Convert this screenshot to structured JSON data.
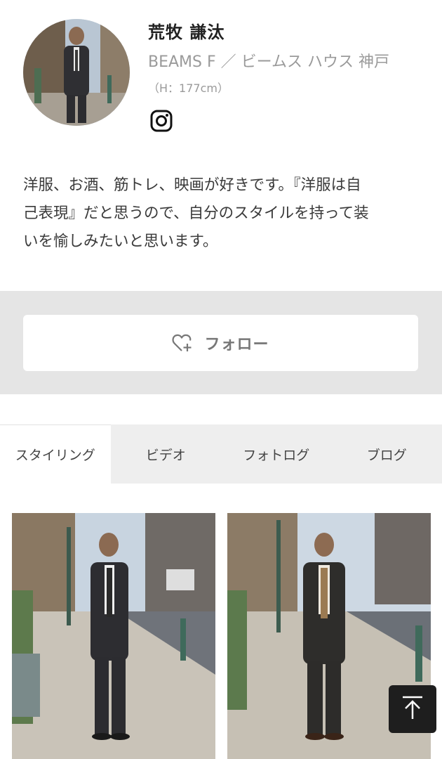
{
  "profile": {
    "name": "荒牧 謙汰",
    "shop": "BEAMS F ／ ビームス ハウス 神戸",
    "height": "（H：177cm）",
    "social_icon": "instagram-icon"
  },
  "bio": {
    "lines": [
      "洋服、お酒、筋トレ、映画が好きです。『洋服は自",
      "己表現』だと思うので、自分のスタイルを持って装",
      "いを愉しみたいと思います。"
    ]
  },
  "follow": {
    "label": "フォロー",
    "icon": "heart-plus-icon"
  },
  "tabs": [
    {
      "label": "スタイリング",
      "active": true
    },
    {
      "label": "ビデオ",
      "active": false
    },
    {
      "label": "フォトログ",
      "active": false
    },
    {
      "label": "ブログ",
      "active": false
    }
  ],
  "back_to_top": {
    "icon": "arrow-up-to-top-icon"
  },
  "colors": {
    "band_gray": "#e5e5e5",
    "tab_gray": "#eeeeee",
    "text_gray": "#9a9a9a",
    "dark": "#1e1e1e"
  }
}
